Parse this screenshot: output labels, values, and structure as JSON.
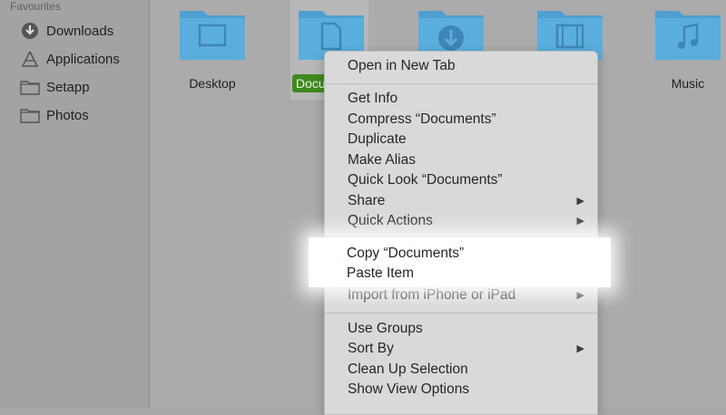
{
  "sidebar": {
    "heading": "Favourites",
    "items": [
      {
        "label": "Downloads",
        "icon": "downloads-icon"
      },
      {
        "label": "Applications",
        "icon": "applications-icon"
      },
      {
        "label": "Setapp",
        "icon": "folder-icon"
      },
      {
        "label": "Photos",
        "icon": "folder-icon"
      }
    ]
  },
  "folders": [
    {
      "label": "Desktop",
      "icon": "desktop-folder-icon"
    },
    {
      "label": "Documents",
      "icon": "documents-folder-icon",
      "visible_label": "Docu"
    },
    {
      "label": "",
      "icon": "downloads-folder-icon"
    },
    {
      "label": "",
      "icon": "movies-folder-icon"
    },
    {
      "label": "Music",
      "icon": "music-folder-icon"
    }
  ],
  "colors": {
    "folder": "#5aa9dc",
    "selection": "#3f8a1f",
    "menu_bg": "#d9d9d9"
  },
  "menu": {
    "group1": [
      "Open in New Tab"
    ],
    "group2": [
      "Get Info",
      "Compress “Documents”",
      "Duplicate",
      "Make Alias",
      "Quick Look “Documents”",
      "Share",
      "Quick Actions"
    ],
    "group3": [
      "Copy “Documents”",
      "Paste Item",
      "Import from iPhone or iPad"
    ],
    "group4": [
      "Use Groups",
      "Sort By",
      "Clean Up Selection",
      "Show View Options"
    ]
  }
}
